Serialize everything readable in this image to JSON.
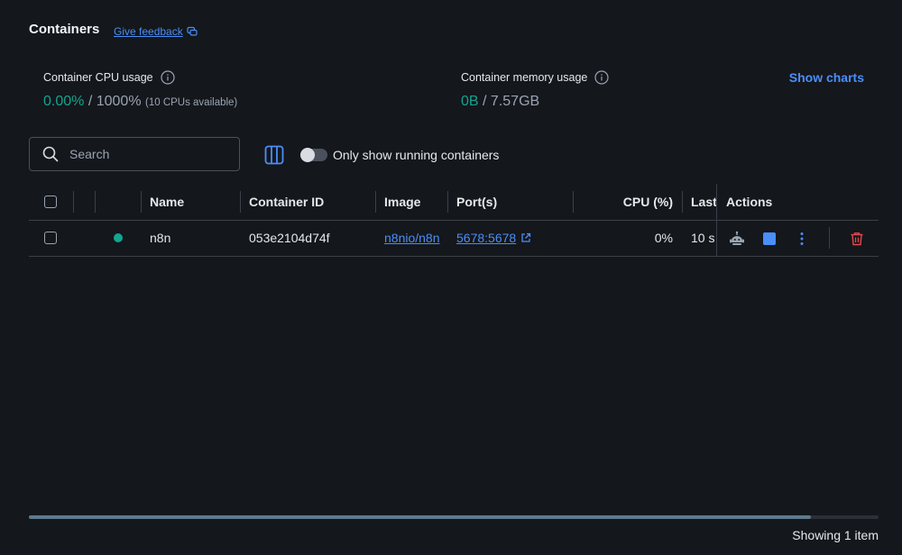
{
  "header": {
    "title": "Containers",
    "feedback_label": "Give feedback"
  },
  "stats": {
    "cpu": {
      "label": "Container CPU usage",
      "used": "0.00%",
      "separator": " / ",
      "total": "1000%",
      "note": "(10 CPUs available)"
    },
    "memory": {
      "label": "Container memory usage",
      "used": "0B",
      "separator": " / ",
      "total": "7.57GB"
    },
    "show_charts_label": "Show charts"
  },
  "toolbar": {
    "search_placeholder": "Search",
    "toggle_label": "Only show running containers",
    "toggle_on": false
  },
  "table": {
    "columns": [
      "Name",
      "Container ID",
      "Image",
      "Port(s)",
      "CPU (%)",
      "Last",
      "Actions"
    ],
    "rows": [
      {
        "status": "running",
        "name": "n8n",
        "container_id": "053e2104d74f",
        "image": "n8nio/n8n",
        "ports": "5678:5678",
        "cpu": "0%",
        "last_started": "10 s"
      }
    ]
  },
  "scrollbar": {
    "thumb_fraction": 0.92
  },
  "footer": {
    "showing": "Showing 1 item"
  },
  "colors": {
    "background": "#14171c",
    "accent": "#4a8ef7",
    "running": "#12a58f",
    "danger": "#e5484d"
  }
}
